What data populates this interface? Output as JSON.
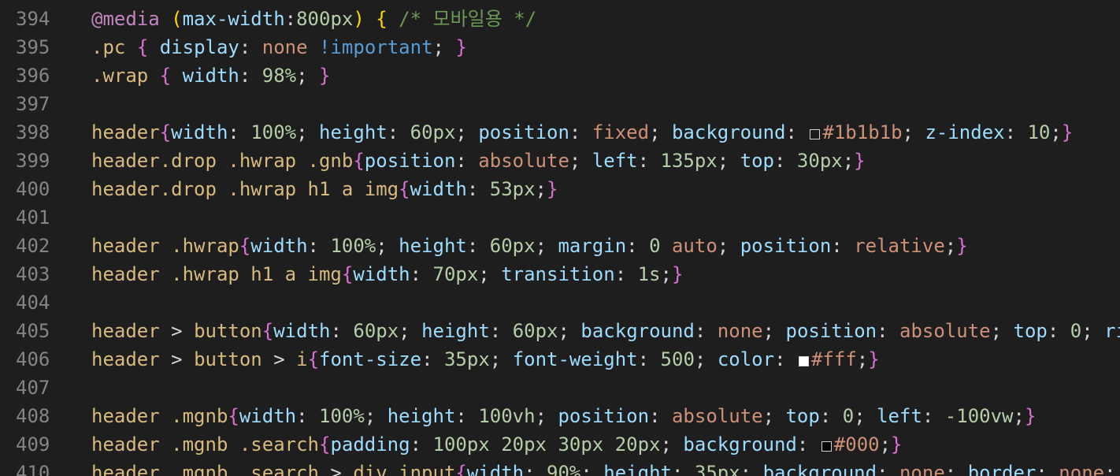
{
  "editor": {
    "colors": {
      "background": "#1e1e1e",
      "line_number": "#858585",
      "selector": "#d7ba7d",
      "at_rule": "#c586c0",
      "property": "#9cdcfe",
      "number": "#b5cea8",
      "value": "#ce9178",
      "keyword": "#569cd6",
      "comment": "#6a9955",
      "punctuation": "#d4d4d4",
      "bracket_gold": "#ffd700",
      "bracket_orchid": "#da70d6"
    },
    "lines": [
      {
        "n": "394",
        "tokens": [
          {
            "t": "at",
            "v": "@media"
          },
          {
            "t": "plain",
            "v": " "
          },
          {
            "t": "b1",
            "v": "("
          },
          {
            "t": "prop",
            "v": "max-width"
          },
          {
            "t": "plain",
            "v": ":"
          },
          {
            "t": "num",
            "v": "800px"
          },
          {
            "t": "b1",
            "v": ")"
          },
          {
            "t": "plain",
            "v": " "
          },
          {
            "t": "b1",
            "v": "{"
          },
          {
            "t": "plain",
            "v": " "
          },
          {
            "t": "com",
            "v": "/* 모바일용 */"
          }
        ]
      },
      {
        "n": "395",
        "tokens": [
          {
            "t": "sel",
            "v": ".pc"
          },
          {
            "t": "plain",
            "v": " "
          },
          {
            "t": "b2",
            "v": "{"
          },
          {
            "t": "plain",
            "v": " "
          },
          {
            "t": "prop",
            "v": "display"
          },
          {
            "t": "plain",
            "v": ": "
          },
          {
            "t": "val",
            "v": "none"
          },
          {
            "t": "plain",
            "v": " "
          },
          {
            "t": "kw",
            "v": "!important"
          },
          {
            "t": "plain",
            "v": "; "
          },
          {
            "t": "b2",
            "v": "}"
          }
        ]
      },
      {
        "n": "396",
        "tokens": [
          {
            "t": "sel",
            "v": ".wrap"
          },
          {
            "t": "plain",
            "v": " "
          },
          {
            "t": "b2",
            "v": "{"
          },
          {
            "t": "plain",
            "v": " "
          },
          {
            "t": "prop",
            "v": "width"
          },
          {
            "t": "plain",
            "v": ": "
          },
          {
            "t": "num",
            "v": "98%"
          },
          {
            "t": "plain",
            "v": "; "
          },
          {
            "t": "b2",
            "v": "}"
          }
        ]
      },
      {
        "n": "397",
        "tokens": []
      },
      {
        "n": "398",
        "tokens": [
          {
            "t": "sel",
            "v": "header"
          },
          {
            "t": "b2",
            "v": "{"
          },
          {
            "t": "prop",
            "v": "width"
          },
          {
            "t": "plain",
            "v": ": "
          },
          {
            "t": "num",
            "v": "100%"
          },
          {
            "t": "plain",
            "v": "; "
          },
          {
            "t": "prop",
            "v": "height"
          },
          {
            "t": "plain",
            "v": ": "
          },
          {
            "t": "num",
            "v": "60px"
          },
          {
            "t": "plain",
            "v": "; "
          },
          {
            "t": "prop",
            "v": "position"
          },
          {
            "t": "plain",
            "v": ": "
          },
          {
            "t": "val",
            "v": "fixed"
          },
          {
            "t": "plain",
            "v": "; "
          },
          {
            "t": "prop",
            "v": "background"
          },
          {
            "t": "plain",
            "v": ": "
          },
          {
            "t": "swatch",
            "v": "#1b1b1b"
          },
          {
            "t": "val",
            "v": "#1b1b1b"
          },
          {
            "t": "plain",
            "v": "; "
          },
          {
            "t": "prop",
            "v": "z-index"
          },
          {
            "t": "plain",
            "v": ": "
          },
          {
            "t": "num",
            "v": "10"
          },
          {
            "t": "plain",
            "v": ";"
          },
          {
            "t": "b2",
            "v": "}"
          }
        ]
      },
      {
        "n": "399",
        "tokens": [
          {
            "t": "sel",
            "v": "header.drop .hwrap .gnb"
          },
          {
            "t": "b2",
            "v": "{"
          },
          {
            "t": "prop",
            "v": "position"
          },
          {
            "t": "plain",
            "v": ": "
          },
          {
            "t": "val",
            "v": "absolute"
          },
          {
            "t": "plain",
            "v": "; "
          },
          {
            "t": "prop",
            "v": "left"
          },
          {
            "t": "plain",
            "v": ": "
          },
          {
            "t": "num",
            "v": "135px"
          },
          {
            "t": "plain",
            "v": "; "
          },
          {
            "t": "prop",
            "v": "top"
          },
          {
            "t": "plain",
            "v": ": "
          },
          {
            "t": "num",
            "v": "30px"
          },
          {
            "t": "plain",
            "v": ";"
          },
          {
            "t": "b2",
            "v": "}"
          }
        ]
      },
      {
        "n": "400",
        "tokens": [
          {
            "t": "sel",
            "v": "header.drop .hwrap h1 a img"
          },
          {
            "t": "b2",
            "v": "{"
          },
          {
            "t": "prop",
            "v": "width"
          },
          {
            "t": "plain",
            "v": ": "
          },
          {
            "t": "num",
            "v": "53px"
          },
          {
            "t": "plain",
            "v": ";"
          },
          {
            "t": "b2",
            "v": "}"
          }
        ]
      },
      {
        "n": "401",
        "tokens": []
      },
      {
        "n": "402",
        "tokens": [
          {
            "t": "sel",
            "v": "header .hwrap"
          },
          {
            "t": "b2",
            "v": "{"
          },
          {
            "t": "prop",
            "v": "width"
          },
          {
            "t": "plain",
            "v": ": "
          },
          {
            "t": "num",
            "v": "100%"
          },
          {
            "t": "plain",
            "v": "; "
          },
          {
            "t": "prop",
            "v": "height"
          },
          {
            "t": "plain",
            "v": ": "
          },
          {
            "t": "num",
            "v": "60px"
          },
          {
            "t": "plain",
            "v": "; "
          },
          {
            "t": "prop",
            "v": "margin"
          },
          {
            "t": "plain",
            "v": ": "
          },
          {
            "t": "num",
            "v": "0"
          },
          {
            "t": "plain",
            "v": " "
          },
          {
            "t": "val",
            "v": "auto"
          },
          {
            "t": "plain",
            "v": "; "
          },
          {
            "t": "prop",
            "v": "position"
          },
          {
            "t": "plain",
            "v": ": "
          },
          {
            "t": "val",
            "v": "relative"
          },
          {
            "t": "plain",
            "v": ";"
          },
          {
            "t": "b2",
            "v": "}"
          }
        ]
      },
      {
        "n": "403",
        "tokens": [
          {
            "t": "sel",
            "v": "header .hwrap h1 a img"
          },
          {
            "t": "b2",
            "v": "{"
          },
          {
            "t": "prop",
            "v": "width"
          },
          {
            "t": "plain",
            "v": ": "
          },
          {
            "t": "num",
            "v": "70px"
          },
          {
            "t": "plain",
            "v": "; "
          },
          {
            "t": "prop",
            "v": "transition"
          },
          {
            "t": "plain",
            "v": ": "
          },
          {
            "t": "num",
            "v": "1s"
          },
          {
            "t": "plain",
            "v": ";"
          },
          {
            "t": "b2",
            "v": "}"
          }
        ]
      },
      {
        "n": "404",
        "tokens": []
      },
      {
        "n": "405",
        "tokens": [
          {
            "t": "sel",
            "v": "header"
          },
          {
            "t": "plain",
            "v": " > "
          },
          {
            "t": "sel",
            "v": "button"
          },
          {
            "t": "b2",
            "v": "{"
          },
          {
            "t": "prop",
            "v": "width"
          },
          {
            "t": "plain",
            "v": ": "
          },
          {
            "t": "num",
            "v": "60px"
          },
          {
            "t": "plain",
            "v": "; "
          },
          {
            "t": "prop",
            "v": "height"
          },
          {
            "t": "plain",
            "v": ": "
          },
          {
            "t": "num",
            "v": "60px"
          },
          {
            "t": "plain",
            "v": "; "
          },
          {
            "t": "prop",
            "v": "background"
          },
          {
            "t": "plain",
            "v": ": "
          },
          {
            "t": "val",
            "v": "none"
          },
          {
            "t": "plain",
            "v": "; "
          },
          {
            "t": "prop",
            "v": "position"
          },
          {
            "t": "plain",
            "v": ": "
          },
          {
            "t": "val",
            "v": "absolute"
          },
          {
            "t": "plain",
            "v": "; "
          },
          {
            "t": "prop",
            "v": "top"
          },
          {
            "t": "plain",
            "v": ": "
          },
          {
            "t": "num",
            "v": "0"
          },
          {
            "t": "plain",
            "v": "; "
          },
          {
            "t": "prop",
            "v": "ri"
          }
        ]
      },
      {
        "n": "406",
        "tokens": [
          {
            "t": "sel",
            "v": "header"
          },
          {
            "t": "plain",
            "v": " > "
          },
          {
            "t": "sel",
            "v": "button"
          },
          {
            "t": "plain",
            "v": " > "
          },
          {
            "t": "sel",
            "v": "i"
          },
          {
            "t": "b2",
            "v": "{"
          },
          {
            "t": "prop",
            "v": "font-size"
          },
          {
            "t": "plain",
            "v": ": "
          },
          {
            "t": "num",
            "v": "35px"
          },
          {
            "t": "plain",
            "v": "; "
          },
          {
            "t": "prop",
            "v": "font-weight"
          },
          {
            "t": "plain",
            "v": ": "
          },
          {
            "t": "num",
            "v": "500"
          },
          {
            "t": "plain",
            "v": "; "
          },
          {
            "t": "prop",
            "v": "color"
          },
          {
            "t": "plain",
            "v": ": "
          },
          {
            "t": "swatch",
            "v": "#ffffff"
          },
          {
            "t": "val",
            "v": "#fff"
          },
          {
            "t": "plain",
            "v": ";"
          },
          {
            "t": "b2",
            "v": "}"
          }
        ]
      },
      {
        "n": "407",
        "tokens": []
      },
      {
        "n": "408",
        "tokens": [
          {
            "t": "sel",
            "v": "header .mgnb"
          },
          {
            "t": "b2",
            "v": "{"
          },
          {
            "t": "prop",
            "v": "width"
          },
          {
            "t": "plain",
            "v": ": "
          },
          {
            "t": "num",
            "v": "100%"
          },
          {
            "t": "plain",
            "v": "; "
          },
          {
            "t": "prop",
            "v": "height"
          },
          {
            "t": "plain",
            "v": ": "
          },
          {
            "t": "num",
            "v": "100vh"
          },
          {
            "t": "plain",
            "v": "; "
          },
          {
            "t": "prop",
            "v": "position"
          },
          {
            "t": "plain",
            "v": ": "
          },
          {
            "t": "val",
            "v": "absolute"
          },
          {
            "t": "plain",
            "v": "; "
          },
          {
            "t": "prop",
            "v": "top"
          },
          {
            "t": "plain",
            "v": ": "
          },
          {
            "t": "num",
            "v": "0"
          },
          {
            "t": "plain",
            "v": "; "
          },
          {
            "t": "prop",
            "v": "left"
          },
          {
            "t": "plain",
            "v": ": "
          },
          {
            "t": "num",
            "v": "-100vw"
          },
          {
            "t": "plain",
            "v": ";"
          },
          {
            "t": "b2",
            "v": "}"
          }
        ]
      },
      {
        "n": "409",
        "tokens": [
          {
            "t": "sel",
            "v": "header .mgnb .search"
          },
          {
            "t": "b2",
            "v": "{"
          },
          {
            "t": "prop",
            "v": "padding"
          },
          {
            "t": "plain",
            "v": ": "
          },
          {
            "t": "num",
            "v": "100px 20px 30px 20px"
          },
          {
            "t": "plain",
            "v": "; "
          },
          {
            "t": "prop",
            "v": "background"
          },
          {
            "t": "plain",
            "v": ": "
          },
          {
            "t": "swatch",
            "v": "#000000"
          },
          {
            "t": "val",
            "v": "#000"
          },
          {
            "t": "plain",
            "v": ";"
          },
          {
            "t": "b2",
            "v": "}"
          }
        ]
      },
      {
        "n": "410",
        "tokens": [
          {
            "t": "sel",
            "v": "header .mgnb .search"
          },
          {
            "t": "plain",
            "v": " > "
          },
          {
            "t": "sel",
            "v": "div input"
          },
          {
            "t": "b2",
            "v": "{"
          },
          {
            "t": "prop",
            "v": "width"
          },
          {
            "t": "plain",
            "v": ": "
          },
          {
            "t": "num",
            "v": "90%"
          },
          {
            "t": "plain",
            "v": "; "
          },
          {
            "t": "prop",
            "v": "height"
          },
          {
            "t": "plain",
            "v": ": "
          },
          {
            "t": "num",
            "v": "35px"
          },
          {
            "t": "plain",
            "v": "; "
          },
          {
            "t": "prop",
            "v": "background"
          },
          {
            "t": "plain",
            "v": ": "
          },
          {
            "t": "val",
            "v": "none"
          },
          {
            "t": "plain",
            "v": "; "
          },
          {
            "t": "prop",
            "v": "border"
          },
          {
            "t": "plain",
            "v": ": "
          },
          {
            "t": "val",
            "v": "none"
          },
          {
            "t": "plain",
            "v": ";"
          }
        ]
      }
    ]
  }
}
